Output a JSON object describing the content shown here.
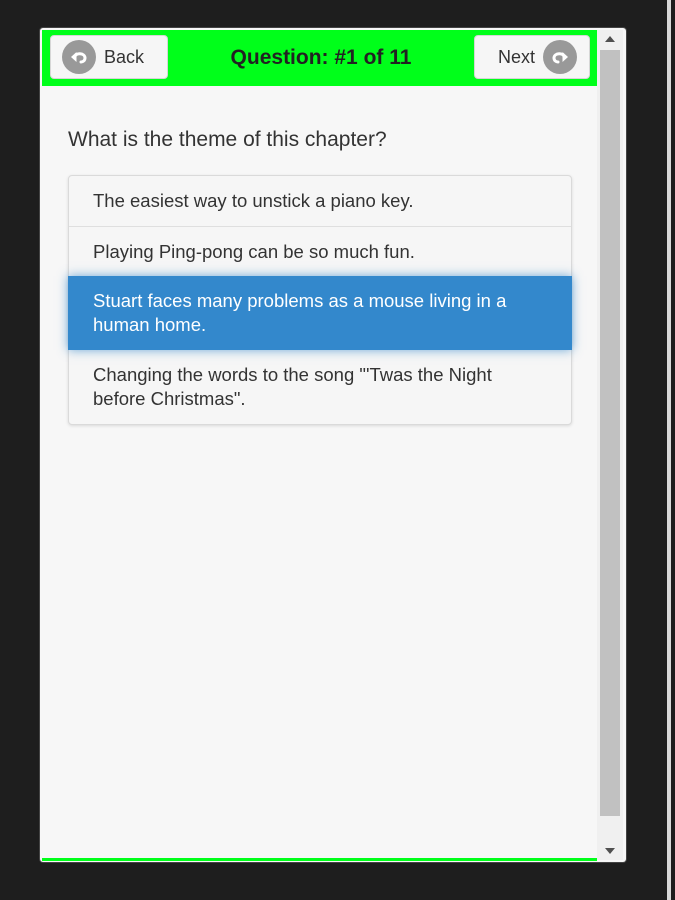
{
  "header": {
    "back_label": "Back",
    "title": "Question: #1 of 11",
    "next_label": "Next"
  },
  "question": {
    "text": "What is the theme of this chapter?"
  },
  "options": [
    {
      "label": "The easiest way to unstick a piano key.",
      "selected": false
    },
    {
      "label": "Playing Ping-pong can be so much fun.",
      "selected": false
    },
    {
      "label": "Stuart faces many problems as a mouse living in a human home.",
      "selected": true
    },
    {
      "label": "Changing the words to the song \"'Twas the Night before Christmas\".",
      "selected": false
    }
  ],
  "colors": {
    "header_bg": "#00ff1a",
    "selected_bg": "#3388cc",
    "page_bg": "#f7f7f7",
    "outer_bg": "#1e1e1e"
  },
  "icons": {
    "back": "undo-arrow-icon",
    "next": "redo-arrow-icon",
    "scroll_up": "chevron-up-icon",
    "scroll_down": "chevron-down-icon"
  }
}
